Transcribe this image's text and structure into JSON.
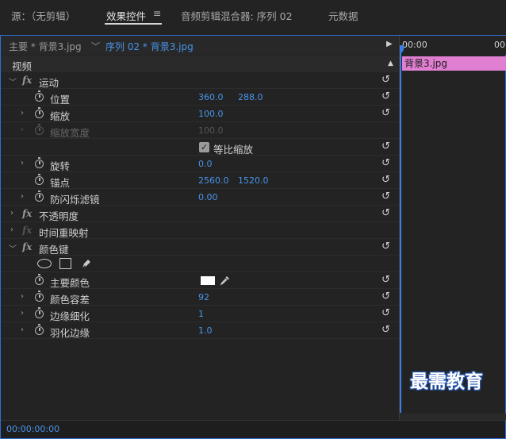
{
  "tabs": [
    {
      "label": "源：（无剪辑）",
      "active": false
    },
    {
      "label": "效果控件",
      "active": true
    },
    {
      "label": "音频剪辑混合器: 序列 02",
      "active": false
    },
    {
      "label": "元数据",
      "active": false
    }
  ],
  "tab_menu_icon": "≡",
  "subheader": {
    "master_clip": "主要 * 背景3.jpg",
    "sequence_clip": "序列 02 * 背景3.jpg"
  },
  "timeline": {
    "timecode_start": "00:00",
    "timecode_end": "00",
    "clip_label": "背景3.jpg",
    "clip_color": "#e07fd2"
  },
  "section_video": "视频",
  "effects": {
    "motion": {
      "name": "运动",
      "position": {
        "label": "位置",
        "x": "360.0",
        "y": "288.0"
      },
      "scale": {
        "label": "缩放",
        "value": "100.0"
      },
      "scale_width": {
        "label": "缩放宽度",
        "value": "100.0"
      },
      "uniform_scale": {
        "label": "等比缩放",
        "checked": true
      },
      "rotation": {
        "label": "旋转",
        "value": "0.0"
      },
      "anchor": {
        "label": "锚点",
        "x": "2560.0",
        "y": "1520.0"
      },
      "anti_flicker": {
        "label": "防闪烁滤镜",
        "value": "0.00"
      }
    },
    "opacity": {
      "name": "不透明度"
    },
    "time_remap": {
      "name": "时间重映射"
    },
    "color_key": {
      "name": "颜色键",
      "key_color": {
        "label": "主要颜色",
        "color": "#ffffff"
      },
      "tolerance": {
        "label": "颜色容差",
        "value": "92"
      },
      "edge_thin": {
        "label": "边缘细化",
        "value": "1"
      },
      "feather": {
        "label": "羽化边缘",
        "value": "1.0"
      }
    }
  },
  "footer_timecode": "00:00:00:00",
  "watermark": "最需教育",
  "colors": {
    "accent": "#4a94ea",
    "playhead": "#3a7ee8",
    "panel_border": "#2f6fd1"
  }
}
